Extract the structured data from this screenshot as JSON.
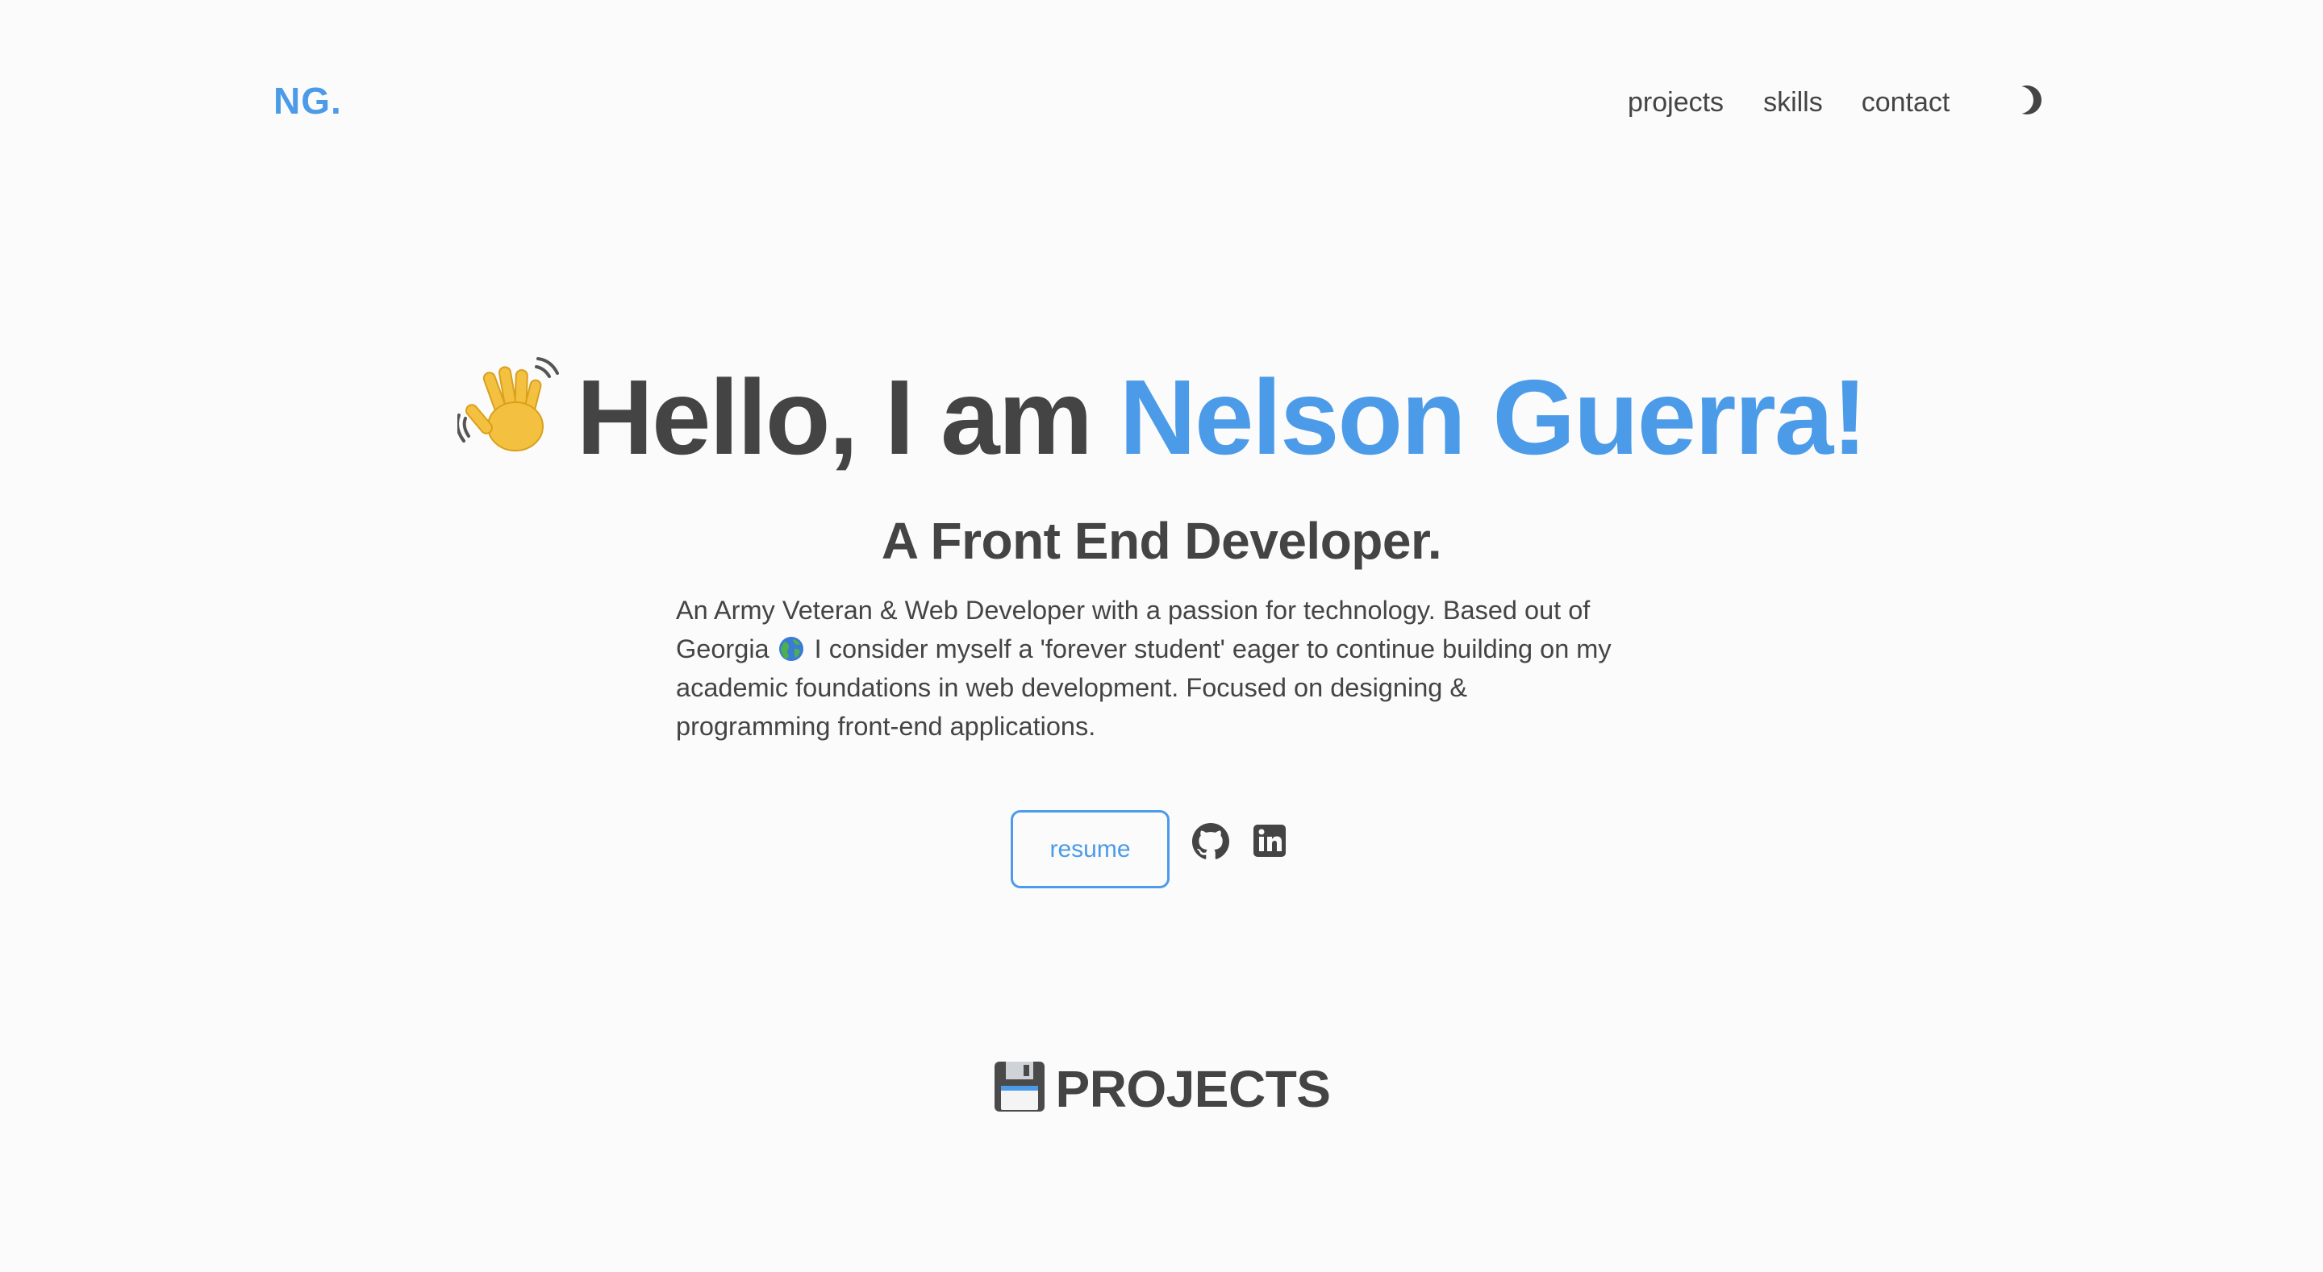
{
  "header": {
    "logo": "NG.",
    "nav": [
      {
        "label": "projects"
      },
      {
        "label": "skills"
      },
      {
        "label": "contact"
      }
    ],
    "theme_toggle_icon": "moon-icon"
  },
  "hero": {
    "greeting": "Hello, I am ",
    "name": "Nelson Guerra!",
    "greeting_icon": "waving-hand-icon",
    "subtitle": "A Front End Developer.",
    "bio_part1": "An Army Veteran & Web Developer with a passion for technology. Based out of Georgia",
    "bio_icon": "globe-icon",
    "bio_part2": " I consider myself a 'forever student' eager to continue building on my academic foundations in web development. Focused on designing & programming front-end applications.",
    "resume_label": "resume",
    "social_icons": [
      "github-icon",
      "linkedin-icon"
    ]
  },
  "projects": {
    "heading": "PROJECTS",
    "heading_icon": "floppy-disk-icon"
  },
  "colors": {
    "accent": "#4c9be8",
    "text": "#444444",
    "background": "#fbfbfb"
  }
}
